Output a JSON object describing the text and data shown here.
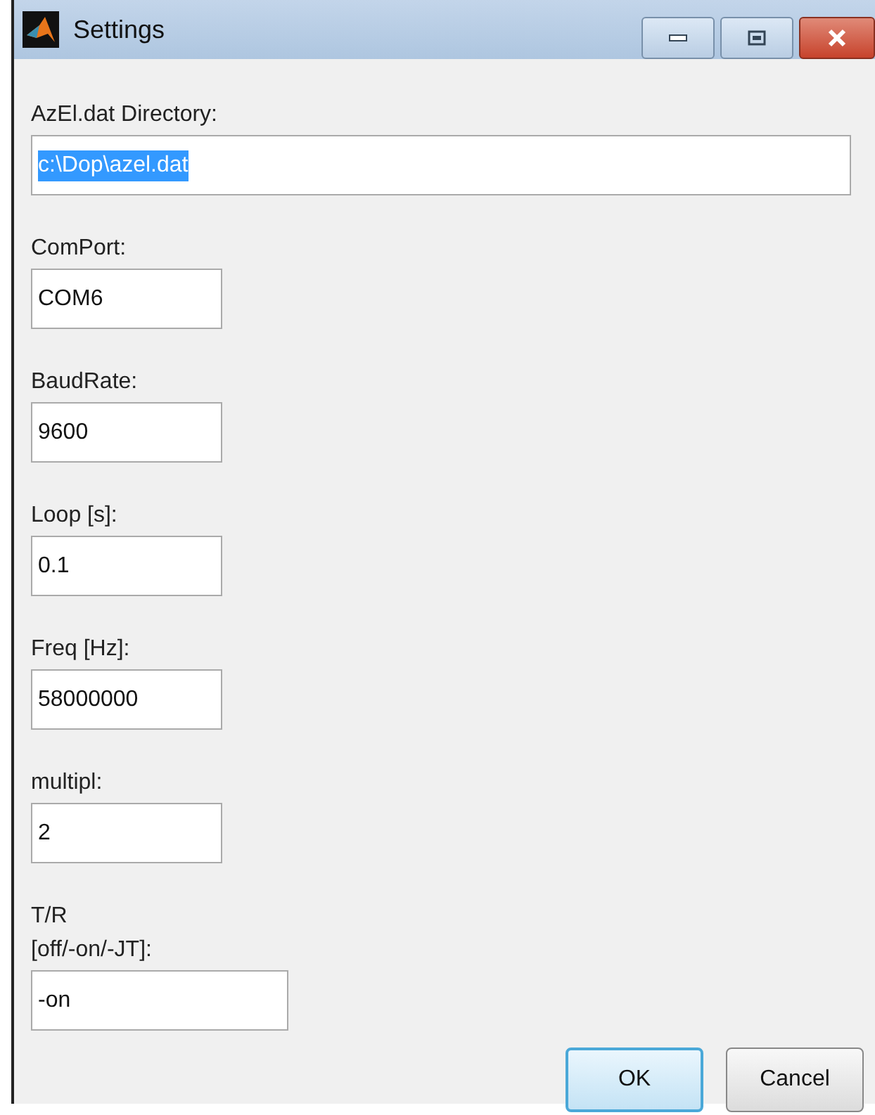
{
  "window": {
    "title": "Settings"
  },
  "fields": [
    {
      "label": "AzEl.dat Directory:",
      "value": "c:\\Dop\\azel.dat",
      "text_selected": true
    },
    {
      "label": "ComPort:",
      "value": "COM6",
      "text_selected": false
    },
    {
      "label": "BaudRate:",
      "value": "9600",
      "text_selected": false
    },
    {
      "label": "Loop [s]:",
      "value": "0.1",
      "text_selected": false
    },
    {
      "label": "Freq [Hz]:",
      "value": "58000000",
      "text_selected": false
    },
    {
      "label": "multipl:",
      "value": "2",
      "text_selected": false
    },
    {
      "label": "T/R\n[off/-on/-JT]:",
      "value": "-on",
      "text_selected": false
    }
  ],
  "buttons": [
    {
      "label": "OK",
      "default": true
    },
    {
      "label": "Cancel",
      "default": false
    }
  ]
}
